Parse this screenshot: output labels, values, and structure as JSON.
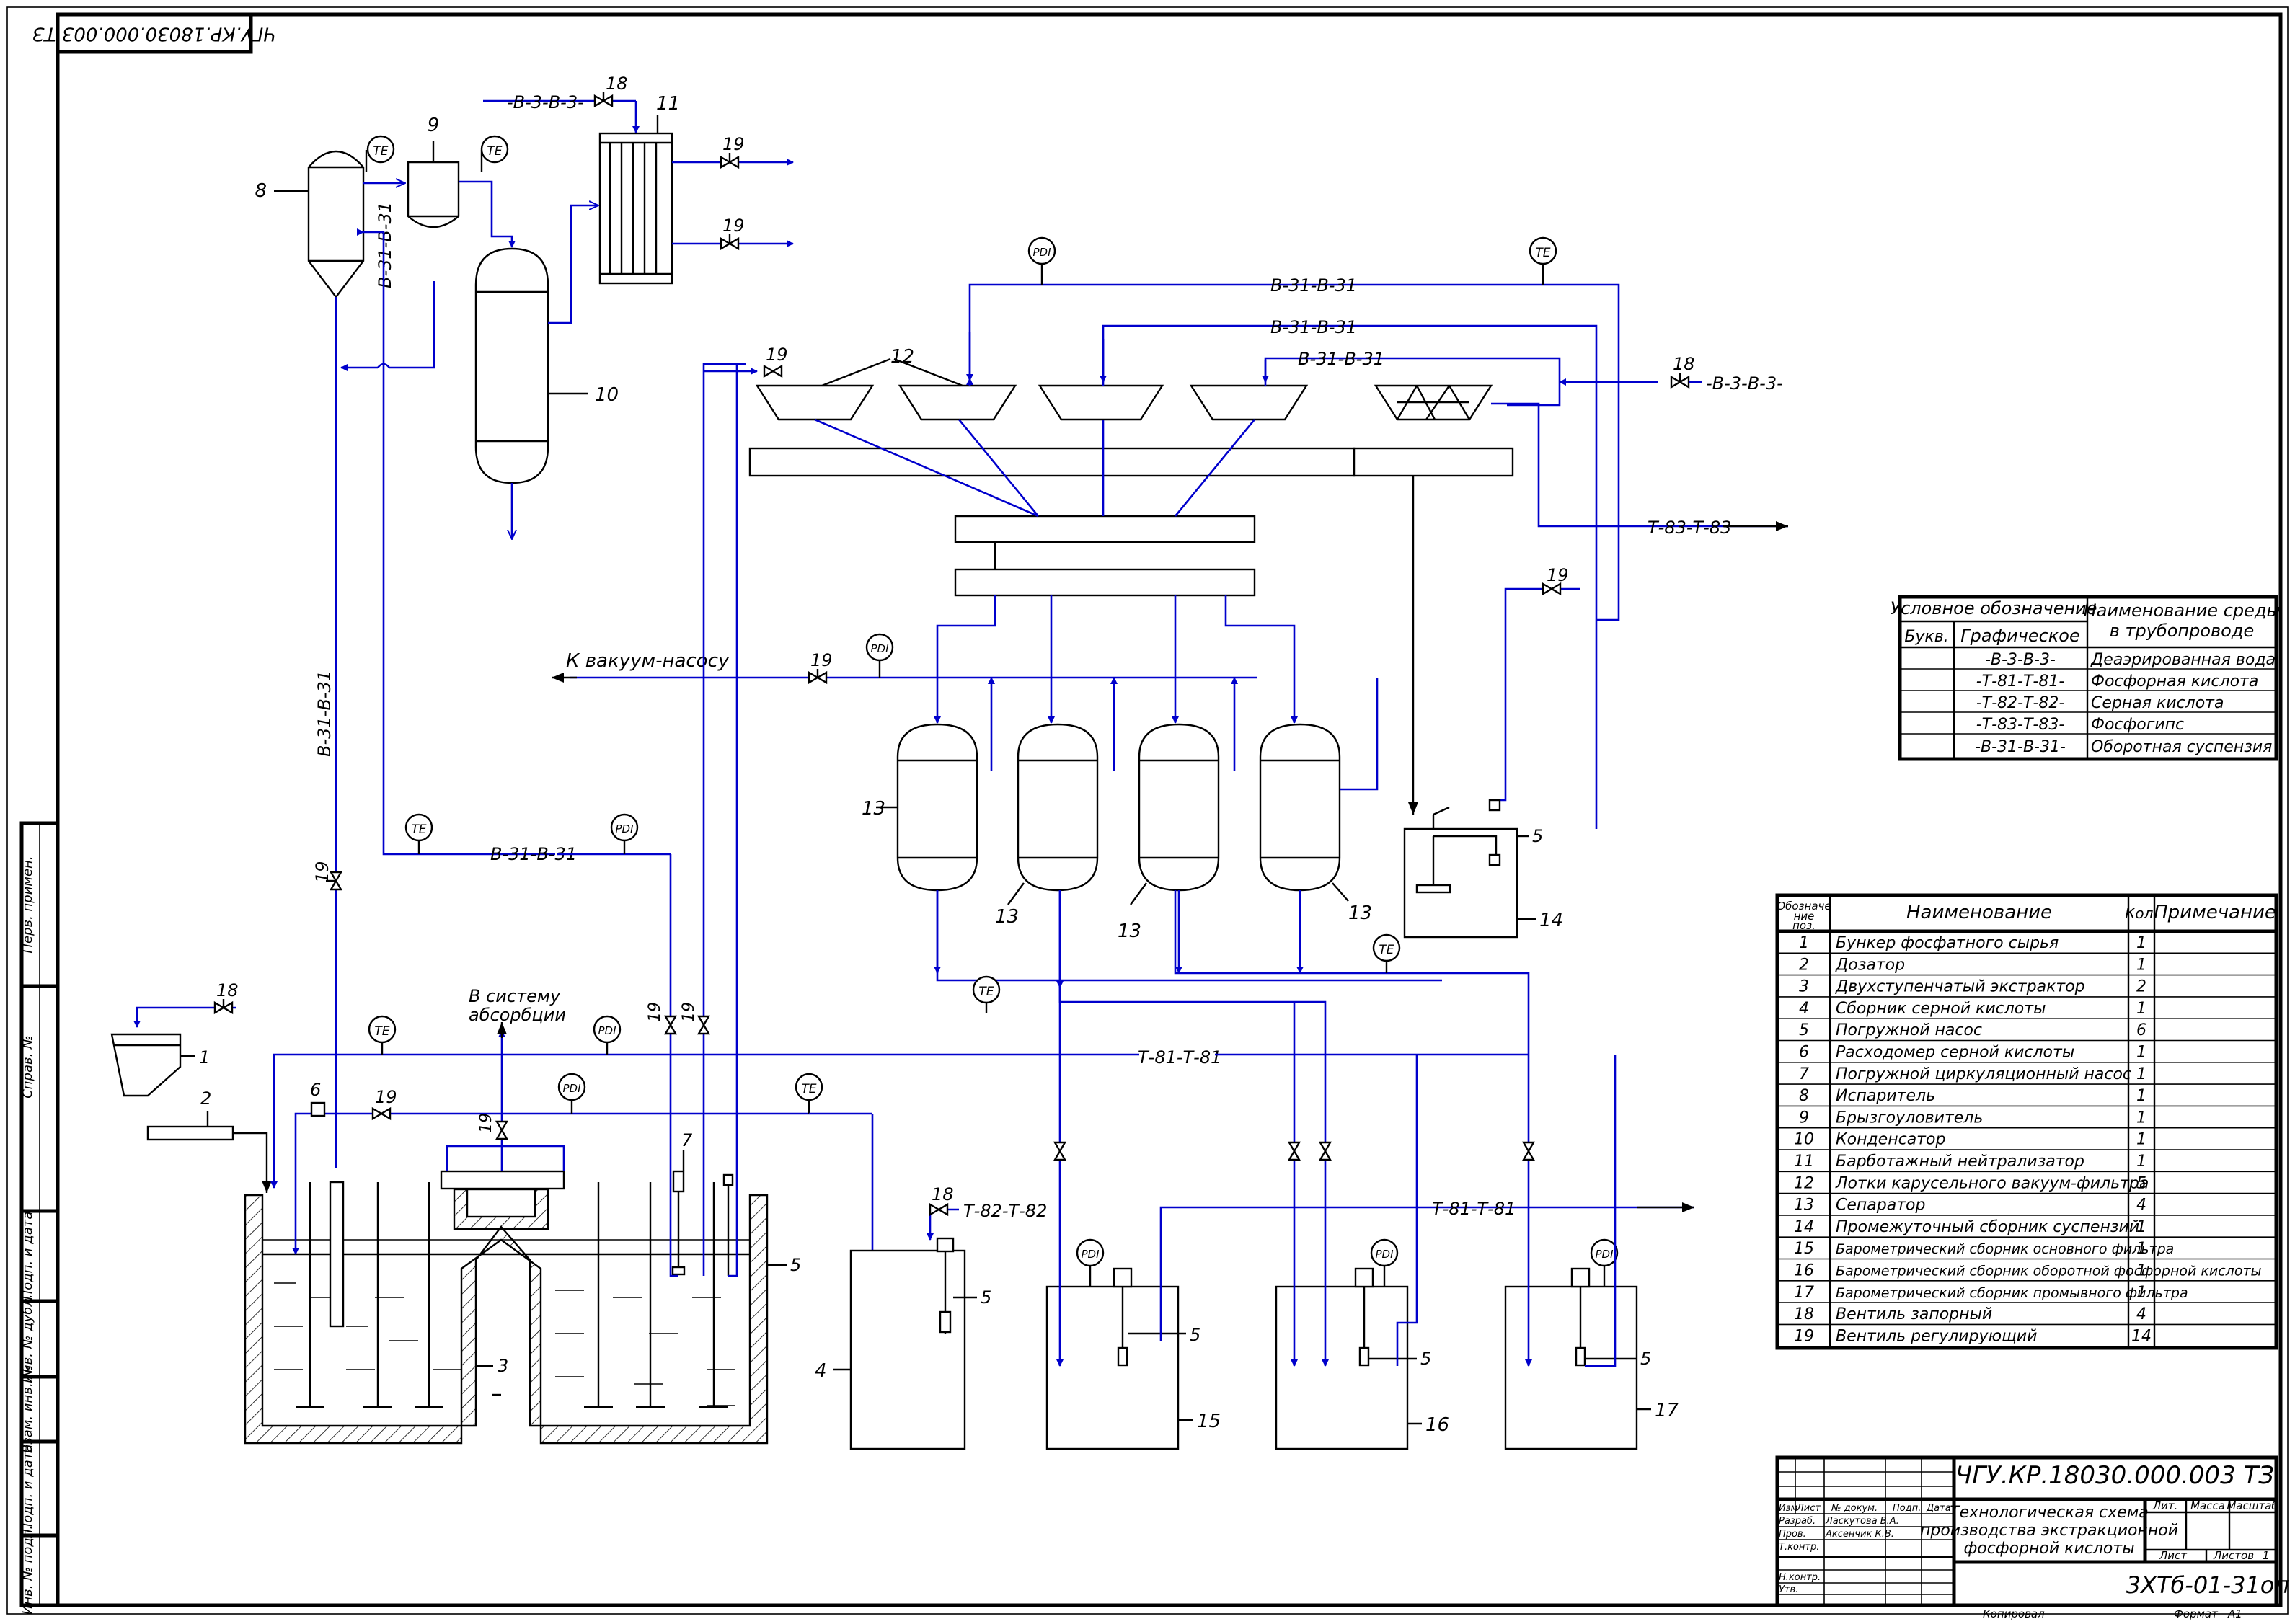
{
  "stamp_code_rotated": "ЧГУ.КР.18030.000.003 ТЗ",
  "lines": {
    "water": "-В-3-В-3-",
    "circ": "В-31-В-31",
    "acid_phos": "Т-81-Т-81",
    "acid_sulf": "Т-82-Т-82",
    "gypsum": "Т-83-Т-83"
  },
  "labels": {
    "vacuum": "К вакуум-насосу",
    "absorb_1": "В систему",
    "absorb_2": "абсорбции",
    "te": "TE",
    "pdi": "PDI"
  },
  "positions": [
    "1",
    "2",
    "3",
    "4",
    "5",
    "6",
    "7",
    "8",
    "9",
    "10",
    "11",
    "12",
    "13",
    "14",
    "15",
    "16",
    "17",
    "18",
    "19"
  ],
  "legend": {
    "h1": "Условное обозначение",
    "h2": "Наименование среды в трубопроводе",
    "h2a": "Наименование среды",
    "h2b": "в трубопроводе",
    "sub1": "Букв.",
    "sub2": "Графическое",
    "rows": [
      {
        "code": "-В-3-В-3-",
        "name": "Деаэрированная вода"
      },
      {
        "code": "-Т-81-Т-81-",
        "name": "Фосфорная кислота"
      },
      {
        "code": "-Т-82-Т-82-",
        "name": "Серная кислота"
      },
      {
        "code": "-Т-83-Т-83-",
        "name": "Фосфогипс"
      },
      {
        "code": "-В-31-В-31-",
        "name": "Оборотная суспензия"
      }
    ]
  },
  "spec": {
    "h_pos_1": "Обозначе",
    "h_pos_2": "ние",
    "h_pos_3": "поз.",
    "h_name": "Наименование",
    "h_qty": "Кол.",
    "h_note": "Примечание",
    "rows": [
      {
        "pos": "1",
        "name": "Бункер фосфатного сырья",
        "qty": "1"
      },
      {
        "pos": "2",
        "name": "Дозатор",
        "qty": "1"
      },
      {
        "pos": "3",
        "name": "Двухступенчатый экстрактор",
        "qty": "2"
      },
      {
        "pos": "4",
        "name": "Сборник серной кислоты",
        "qty": "1"
      },
      {
        "pos": "5",
        "name": "Погружной насос",
        "qty": "6"
      },
      {
        "pos": "6",
        "name": "Расходомер серной кислоты",
        "qty": "1"
      },
      {
        "pos": "7",
        "name": "Погружной циркуляционный насос",
        "qty": "1"
      },
      {
        "pos": "8",
        "name": "Испаритель",
        "qty": "1"
      },
      {
        "pos": "9",
        "name": "Брызгоуловитель",
        "qty": "1"
      },
      {
        "pos": "10",
        "name": "Конденсатор",
        "qty": "1"
      },
      {
        "pos": "11",
        "name": "Барботажный нейтрализатор",
        "qty": "1"
      },
      {
        "pos": "12",
        "name": "Лотки карусельного вакуум-фильтра",
        "qty": "5"
      },
      {
        "pos": "13",
        "name": "Сепаратор",
        "qty": "4"
      },
      {
        "pos": "14",
        "name": "Промежуточный сборник суспензий",
        "qty": "1"
      },
      {
        "pos": "15",
        "name": "Барометрический сборник основного фильтра",
        "qty": "1"
      },
      {
        "pos": "16",
        "name": "Барометрический сборник оборотной фосфорной кислоты",
        "qty": "1"
      },
      {
        "pos": "17",
        "name": "Барометрический сборник промывного фильтра",
        "qty": "1"
      },
      {
        "pos": "18",
        "name": "Вентиль запорный",
        "qty": "4"
      },
      {
        "pos": "19",
        "name": "Вентиль регулирующий",
        "qty": "14"
      }
    ]
  },
  "title_block": {
    "code": "ЧГУ.КР.18030.000.003 ТЗ",
    "title_1": "Технологическая схема",
    "title_2": "производства экстракционной",
    "title_3": "фосфорной кислоты",
    "group": "3ХТб-01-31оп",
    "cols": {
      "izm": "Изм",
      "list": "Лист",
      "doc": "№ докум.",
      "podp": "Подп.",
      "data": "Дата"
    },
    "roles": {
      "razrab": "Разраб.",
      "prov": "Пров.",
      "tkontr": "Т.контр.",
      "nkontr": "Н.контр.",
      "utv": "Утв."
    },
    "people": {
      "razrab": "Ласкутова В.А.",
      "prov": "Аксенчик К.В."
    },
    "lit": "Лит.",
    "massa": "Масса",
    "masshtab": "Масштаб",
    "sheet": "Лист",
    "sheets": "Листов",
    "sheets_n": "1",
    "copied": "Копировал",
    "format": "Формат",
    "format_v": "А1"
  },
  "side_stamp": [
    "Перв. примен.",
    "Справ. №",
    "Подп. и дата",
    "Инв. № дубл.",
    "Взам. инв. №",
    "Подп. и дата",
    "Инв. № подл."
  ],
  "colors": {
    "pipe": "#0000cc",
    "line": "#000000"
  }
}
